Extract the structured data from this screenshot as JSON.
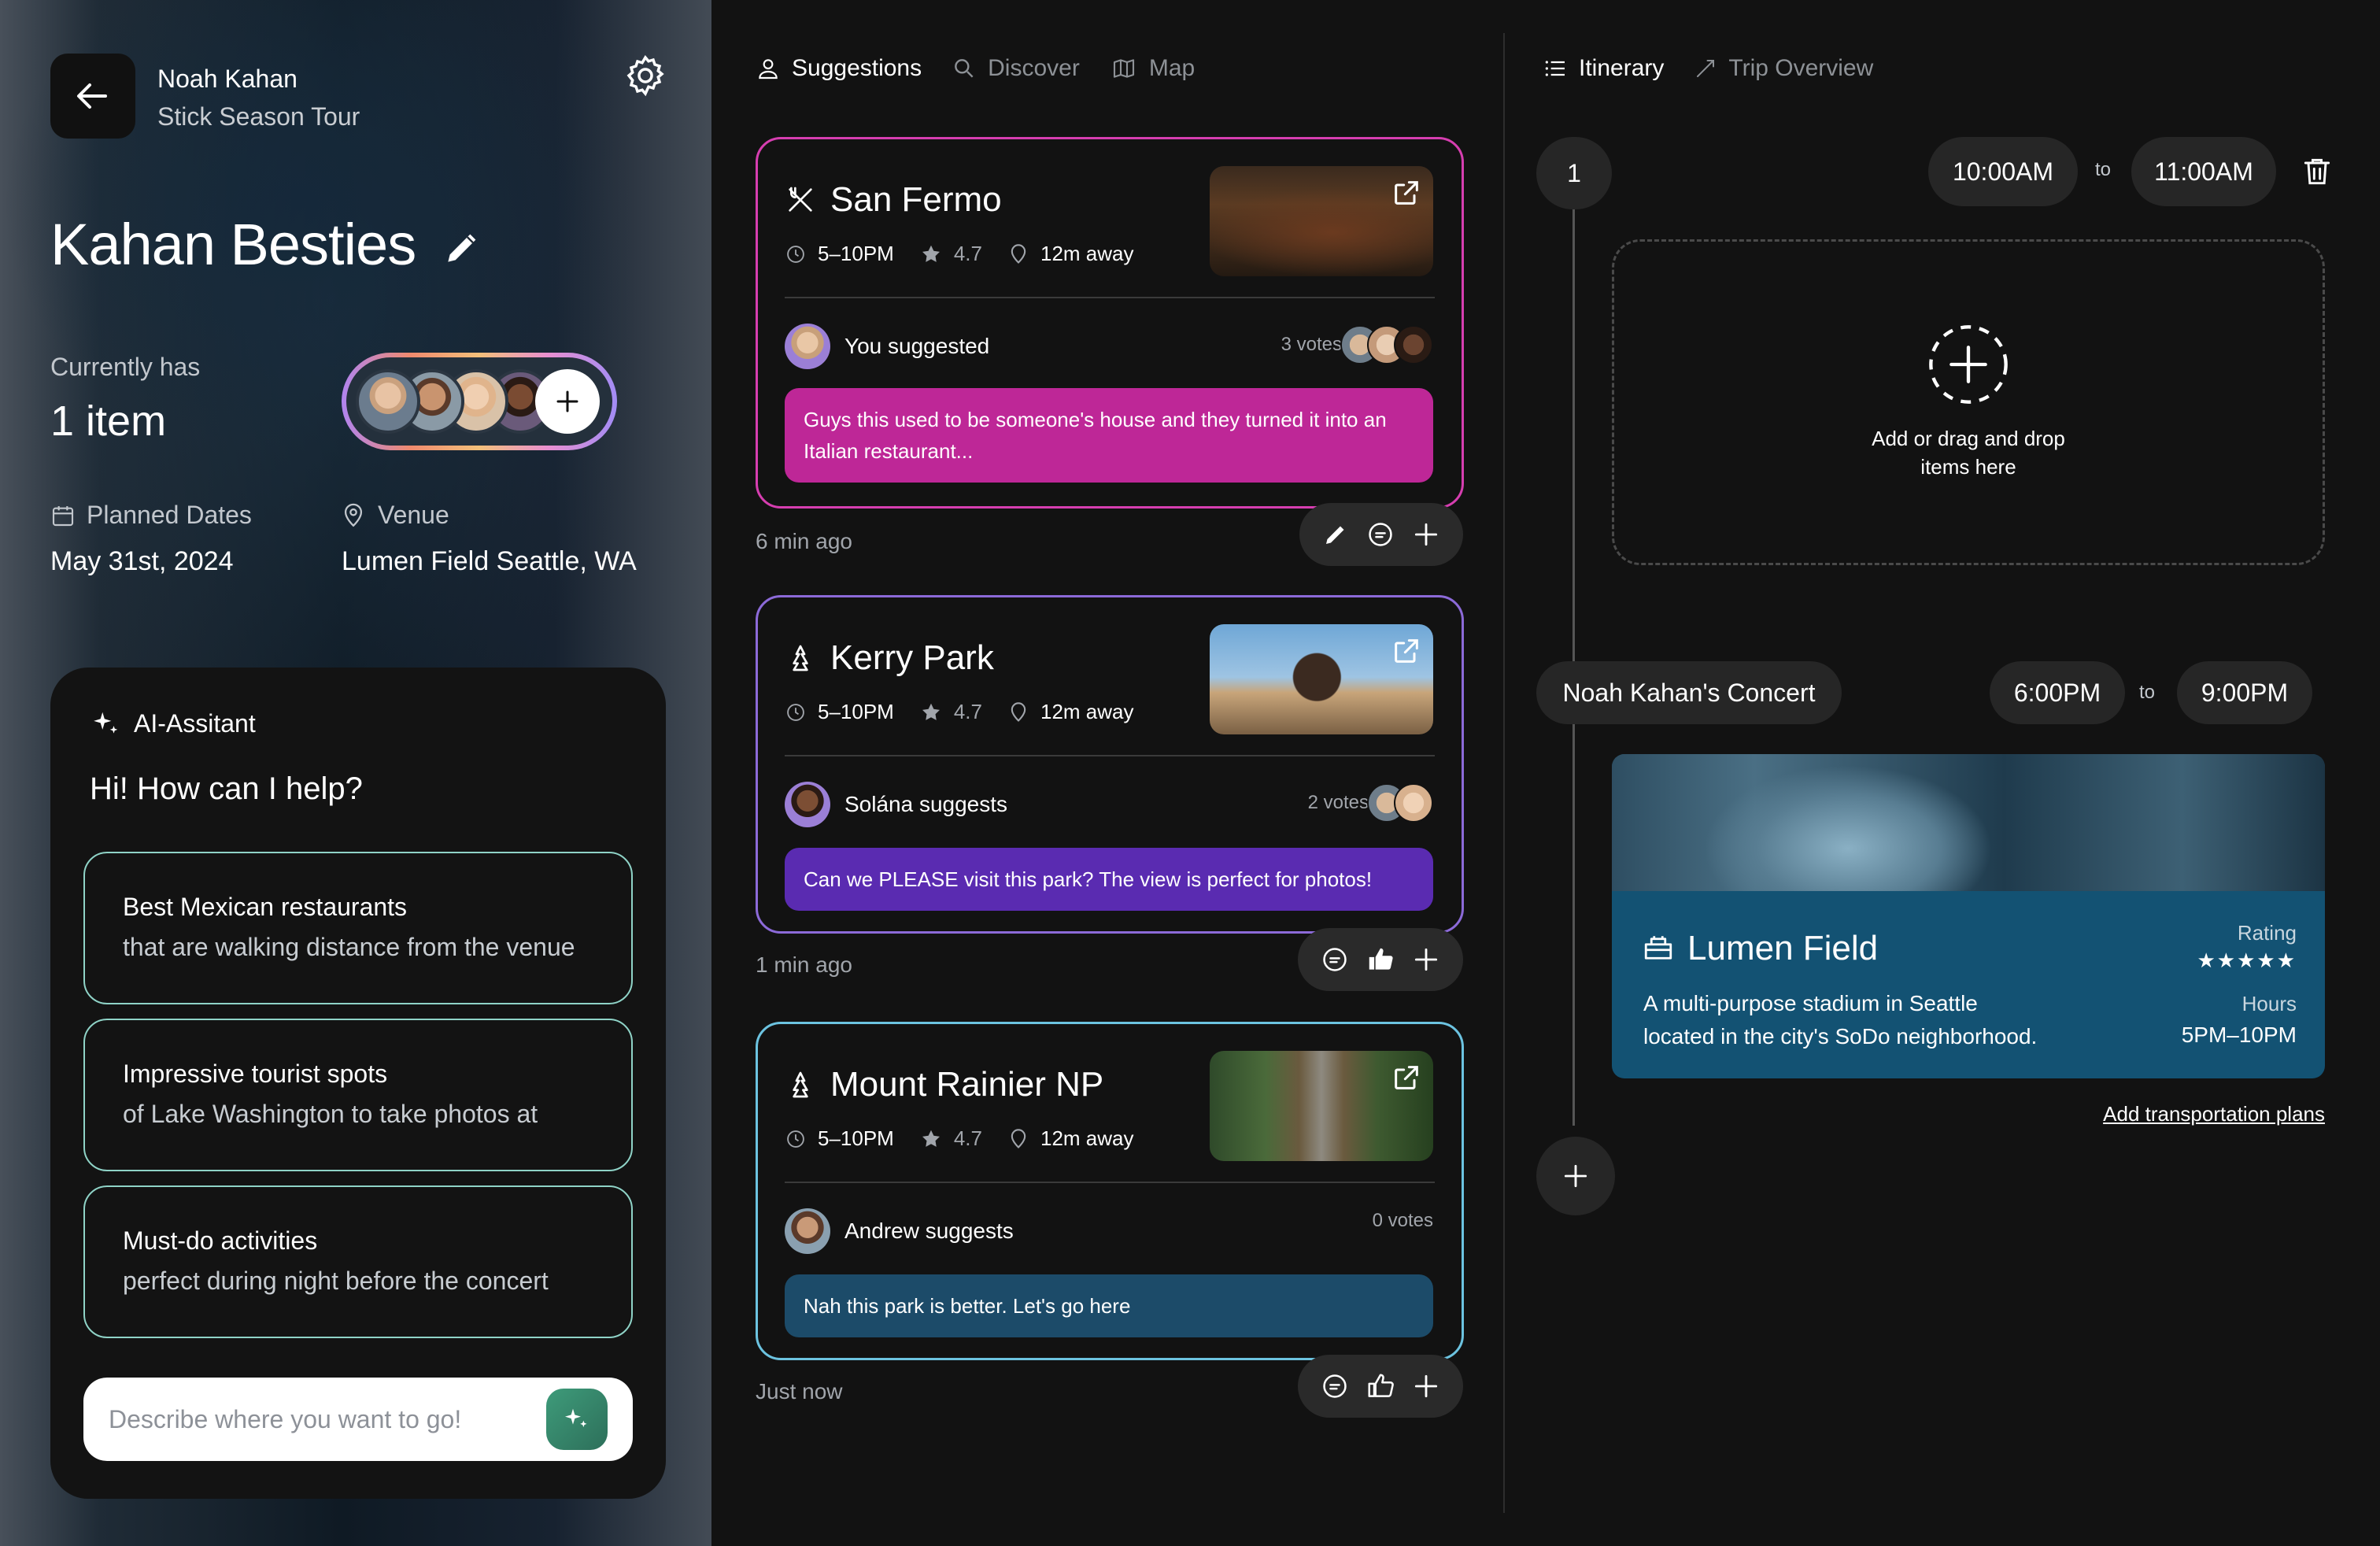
{
  "header": {
    "artist": "Noah Kahan",
    "tour": "Stick Season Tour"
  },
  "group": {
    "title": "Kahan Besties",
    "currently_label": "Currently has",
    "item_count": "1 item",
    "dates_label": "Planned Dates",
    "dates_value": "May 31st, 2024",
    "venue_label": "Venue",
    "venue_value": "Lumen Field Seattle, WA"
  },
  "assistant": {
    "title": "AI-Assitant",
    "greeting": "Hi! How can I help?",
    "suggestions": [
      {
        "line1": "Best Mexican restaurants",
        "line2": "that are walking distance from the venue"
      },
      {
        "line1": "Impressive tourist spots",
        "line2": "of Lake Washington to take photos at"
      },
      {
        "line1": "Must-do activities",
        "line2": "perfect during night before the concert"
      }
    ],
    "input_placeholder": "Describe where you want to go!"
  },
  "tabs": {
    "suggestions": "Suggestions",
    "discover": "Discover",
    "map": "Map"
  },
  "cards": [
    {
      "title": "San Fermo",
      "icon": "utensils-icon",
      "hours": "5–10PM",
      "rating": "4.7",
      "distance": "12m away",
      "suggester": "You suggested",
      "votes": "3 votes",
      "message": "Guys this used to be someone's house and they turned it into an Italian restaurant...",
      "ago": "6 min ago",
      "accent": "#c0279a"
    },
    {
      "title": "Kerry Park",
      "icon": "mountain-icon",
      "hours": "5–10PM",
      "rating": "4.7",
      "distance": "12m away",
      "suggester": "Solána suggests",
      "votes": "2 votes",
      "message": "Can we PLEASE visit this park? The view is perfect for photos!",
      "ago": "1 min ago",
      "accent": "#5b2bb3"
    },
    {
      "title": "Mount Rainier NP",
      "icon": "mountain-icon",
      "hours": "5–10PM",
      "rating": "4.7",
      "distance": "12m away",
      "suggester": "Andrew suggests",
      "votes": "0 votes",
      "message": "Nah this park is better. Let's go here",
      "ago": "Just now",
      "accent": "#1d4d6b"
    }
  ],
  "itinerary": {
    "tab_itinerary": "Itinerary",
    "tab_overview": "Trip Overview",
    "slot_number": "1",
    "slot1_start": "10:00AM",
    "slot1_to": "to",
    "slot1_end": "11:00AM",
    "dropzone_text_1": "Add or drag and drop",
    "dropzone_text_2": "items here",
    "event_name": "Noah Kahan's Concert",
    "event_start": "6:00PM",
    "event_to": "to",
    "event_end": "9:00PM",
    "venue_title": "Lumen Field",
    "venue_desc_1": "A multi-purpose stadium in Seattle",
    "venue_desc_2": "located in the city's SoDo neighborhood.",
    "rating_label": "Rating",
    "rating_stars": "★★★★★",
    "hours_label": "Hours",
    "hours_value": "5PM–10PM",
    "transport_link": "Add transportation plans"
  }
}
